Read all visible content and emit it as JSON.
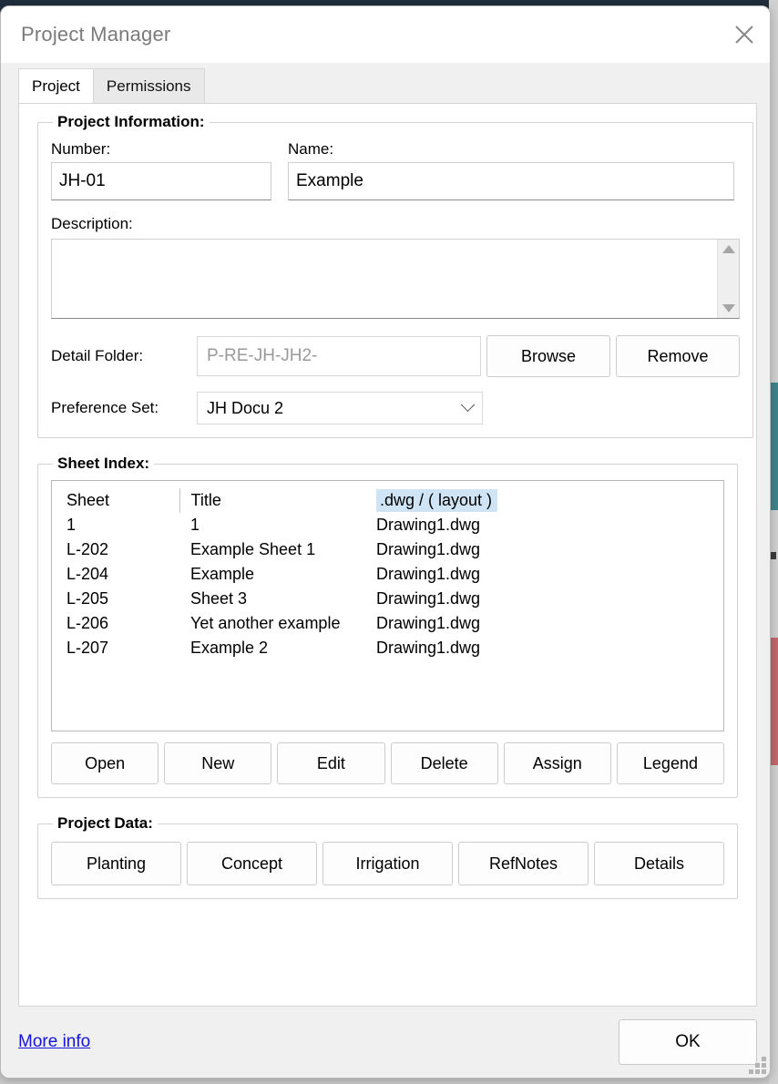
{
  "window": {
    "title": "Project Manager",
    "close_icon": "close-icon"
  },
  "tabs": [
    {
      "label": "Project",
      "active": true
    },
    {
      "label": "Permissions",
      "active": false
    }
  ],
  "project_information": {
    "legend": "Project Information:",
    "number_label": "Number:",
    "number_value": "JH-01",
    "name_label": "Name:",
    "name_value": "Example",
    "description_label": "Description:",
    "description_value": "",
    "detail_folder_label": "Detail Folder:",
    "detail_folder_value": "P-RE-JH-JH2-",
    "browse_label": "Browse",
    "remove_label": "Remove",
    "preference_set_label": "Preference Set:",
    "preference_set_value": "JH Docu 2"
  },
  "sheet_index": {
    "legend": "Sheet Index:",
    "columns": [
      "Sheet",
      "Title",
      ".dwg / ( layout )"
    ],
    "highlighted_column": ".dwg / ( layout )",
    "rows": [
      {
        "sheet": "1",
        "title": "1",
        "dwg": "Drawing1.dwg"
      },
      {
        "sheet": "L-202",
        "title": "Example Sheet 1",
        "dwg": "Drawing1.dwg"
      },
      {
        "sheet": "L-204",
        "title": "Example",
        "dwg": "Drawing1.dwg"
      },
      {
        "sheet": "L-205",
        "title": "Sheet 3",
        "dwg": "Drawing1.dwg"
      },
      {
        "sheet": "L-206",
        "title": "Yet another example",
        "dwg": "Drawing1.dwg"
      },
      {
        "sheet": "L-207",
        "title": "Example 2",
        "dwg": "Drawing1.dwg"
      }
    ],
    "buttons": [
      "Open",
      "New",
      "Edit",
      "Delete",
      "Assign",
      "Legend"
    ]
  },
  "project_data": {
    "legend": "Project Data:",
    "buttons": [
      "Planting",
      "Concept",
      "Irrigation",
      "RefNotes",
      "Details"
    ]
  },
  "footer": {
    "more_info_label": "More info",
    "ok_label": "OK"
  },
  "colors": {
    "highlight": "#cfe5f5",
    "link": "#1414e0",
    "title_text": "#7b7b7b",
    "panel_bg": "#ffffff",
    "dialog_bg": "#f0f0f0"
  }
}
